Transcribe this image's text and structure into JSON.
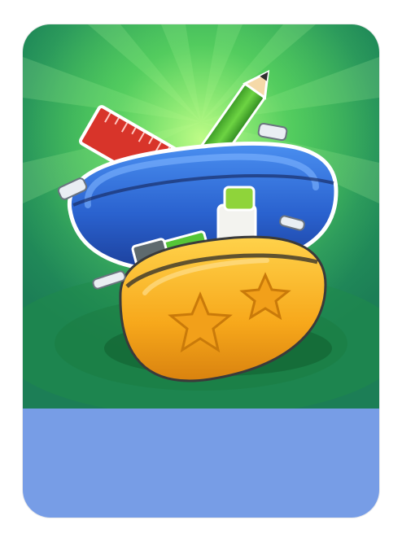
{
  "card": {
    "item_name": "pencil-case",
    "colors": {
      "background_light": "#6fe06c",
      "background_dark": "#1c7e56",
      "footer": "#779de6",
      "blue_case": "#2f6fd6",
      "yellow_case": "#f6a91c",
      "ruler": "#d8342a",
      "pencil": "#4cb52f",
      "marker_cap": "#8fd43a"
    }
  }
}
